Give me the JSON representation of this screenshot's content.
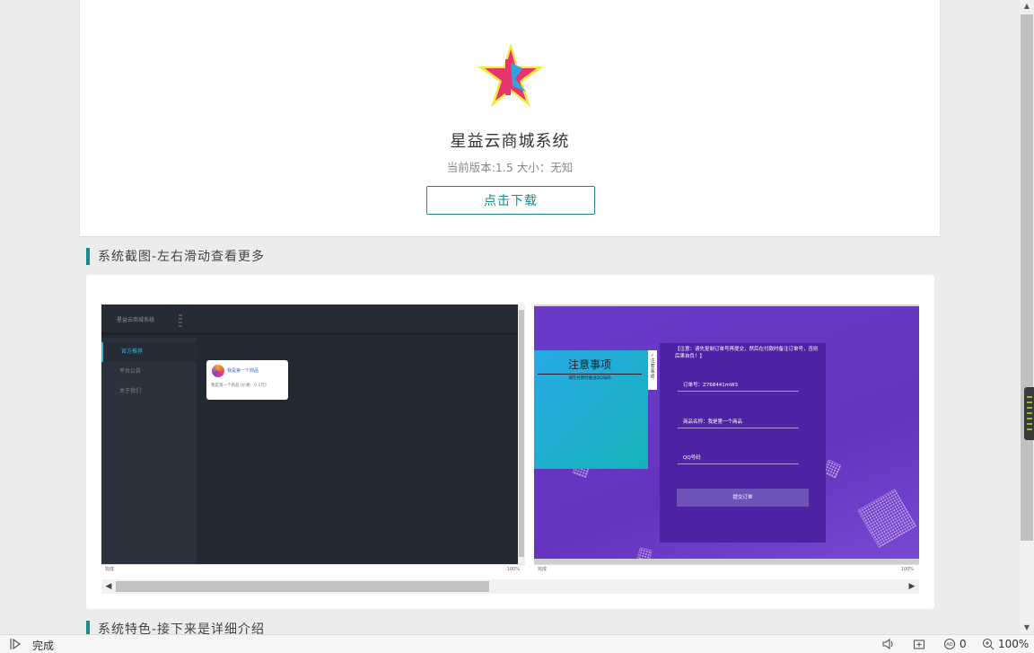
{
  "app": {
    "name": "星益云商城系统",
    "meta": "当前版本:1.5 大小：无知",
    "download_label": "点击下载",
    "accent": "#1a8a8a"
  },
  "sections": {
    "screenshots_title": "系统截图-左右滑动查看更多",
    "features_title": "系统特色-接下来是详细介绍"
  },
  "shot1": {
    "title": "星益云商城系统",
    "menu": [
      "官方推荐",
      "平台公告",
      "关于我们"
    ],
    "card_name": "我是第一个商品",
    "card_desc": "我是第一个商品 [价格：0.1元]",
    "status_left": "完成",
    "status_right": "100%"
  },
  "shot2": {
    "notice_title": "注意事项",
    "notice_sub": "请在付款时备注QQ号码",
    "tab_label": "注意事项",
    "tip": "【注意：请先复制订单号再提交，然后在付款时备注订单号，否则后果自负！】",
    "fields": [
      "订单号：Z768441mW3",
      "商品名称：我是第一个商品",
      "QQ号码"
    ],
    "submit": "提交订单",
    "status_left": "完成",
    "status_right": "100%"
  },
  "statusbar": {
    "status": "完成",
    "blocked": "0",
    "zoom": "100%"
  }
}
